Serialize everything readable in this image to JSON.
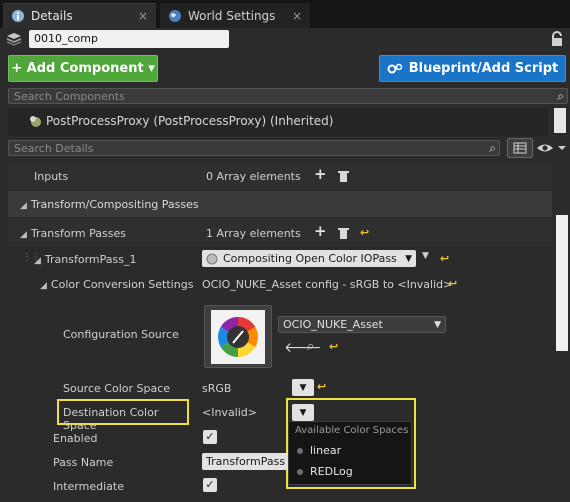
{
  "tabs": [
    {
      "label": "Details",
      "close": "×"
    },
    {
      "label": "World Settings",
      "close": "×"
    }
  ],
  "actor_name": "0010_comp",
  "toolbar": {
    "add_component": "+ Add Component ▾",
    "blueprint": "Blueprint/Add Script"
  },
  "search_components": {
    "placeholder": "Search Components"
  },
  "components": [
    {
      "label": "PostProcessProxy (PostProcessProxy) (Inherited)"
    }
  ],
  "search_details": {
    "placeholder": "Search Details"
  },
  "details": {
    "inputs": {
      "label": "Inputs",
      "value": "0 Array elements"
    },
    "category": "Transform/Compositing Passes",
    "transform_passes": {
      "label": "Transform Passes",
      "value": "1 Array elements"
    },
    "transform_pass_1": {
      "label": "TransformPass_1",
      "value": "Compositing Open Color IOPass"
    },
    "color_conversion": {
      "label": "Color Conversion Settings",
      "value": "OCIO_NUKE_Asset config - sRGB to <Invalid>"
    },
    "configuration_source": {
      "label": "Configuration Source",
      "asset": "OCIO_NUKE_Asset"
    },
    "source_color_space": {
      "label": "Source Color Space",
      "value": "sRGB"
    },
    "destination_color_space": {
      "label": "Destination Color Space",
      "value": "<Invalid>"
    },
    "enabled": {
      "label": "Enabled",
      "checked": true
    },
    "pass_name": {
      "label": "Pass Name",
      "value": "TransformPass"
    },
    "intermediate": {
      "label": "Intermediate",
      "checked": true
    }
  },
  "color_space_popup": {
    "title": "Available Color Spaces",
    "options": [
      "linear",
      "REDLog"
    ]
  },
  "colors": {
    "add_button": "#4fa73a",
    "blueprint_button": "#1a74c8",
    "highlight": "#f2e043",
    "revert_arrow": "#e8c53a"
  }
}
